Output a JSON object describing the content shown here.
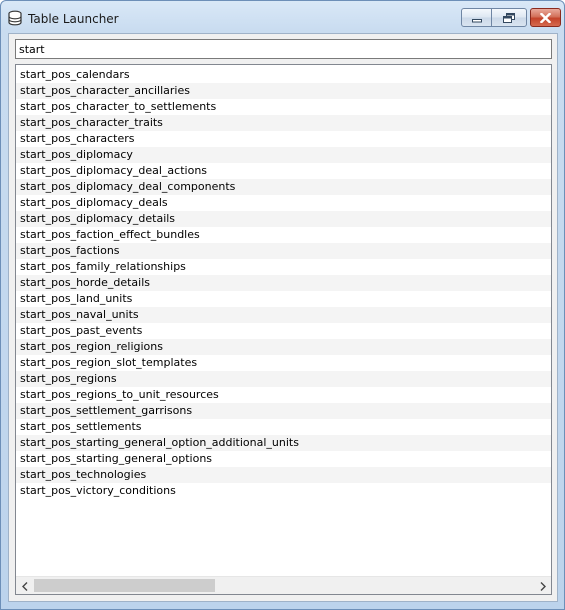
{
  "window": {
    "title": "Table Launcher",
    "icon": "database-icon"
  },
  "caption_buttons": {
    "minimize": "minimize-icon",
    "restore": "restore-icon",
    "close": "close-icon"
  },
  "search": {
    "value": "start"
  },
  "list": {
    "items": [
      "start_pos_calendars",
      "start_pos_character_ancillaries",
      "start_pos_character_to_settlements",
      "start_pos_character_traits",
      "start_pos_characters",
      "start_pos_diplomacy",
      "start_pos_diplomacy_deal_actions",
      "start_pos_diplomacy_deal_components",
      "start_pos_diplomacy_deals",
      "start_pos_diplomacy_details",
      "start_pos_faction_effect_bundles",
      "start_pos_factions",
      "start_pos_family_relationships",
      "start_pos_horde_details",
      "start_pos_land_units",
      "start_pos_naval_units",
      "start_pos_past_events",
      "start_pos_region_religions",
      "start_pos_region_slot_templates",
      "start_pos_regions",
      "start_pos_regions_to_unit_resources",
      "start_pos_settlement_garrisons",
      "start_pos_settlements",
      "start_pos_starting_general_option_additional_units",
      "start_pos_starting_general_options",
      "start_pos_technologies",
      "start_pos_victory_conditions"
    ]
  },
  "scrollbar": {
    "horizontal_position": 0
  }
}
